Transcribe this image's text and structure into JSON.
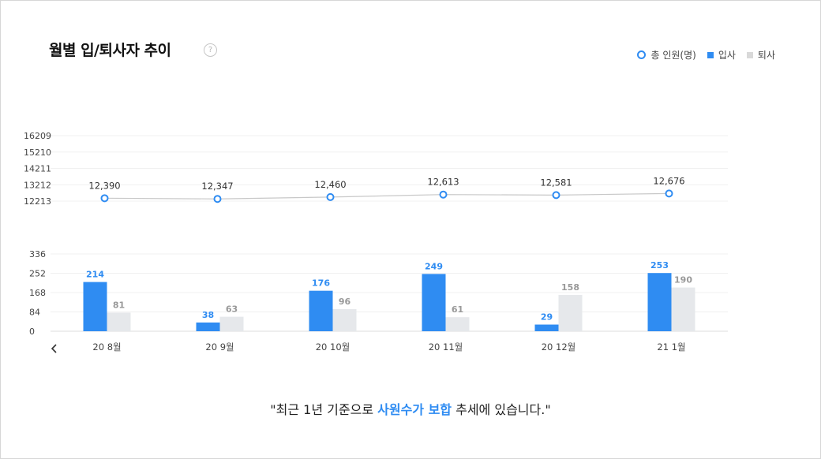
{
  "title": "월별 입/퇴사자 추이",
  "help_icon": "?",
  "legend": [
    {
      "label": "총 인원(명)",
      "marker": "circle",
      "color": "#2f8cf2"
    },
    {
      "label": "입사",
      "marker": "square",
      "color": "#2f8cf2"
    },
    {
      "label": "퇴사",
      "marker": "square",
      "color": "#d9d9d9"
    }
  ],
  "chart_data": [
    {
      "type": "line",
      "series": [
        {
          "name": "총 인원(명)",
          "values": [
            12390,
            12347,
            12460,
            12613,
            12581,
            12676
          ],
          "labels": [
            "12,390",
            "12,347",
            "12,460",
            "12,613",
            "12,581",
            "12,676"
          ]
        }
      ],
      "categories": [
        "20 8월",
        "20 9월",
        "20 10월",
        "20 11월",
        "20 12월",
        "21 1월"
      ],
      "yticks": [
        16209,
        15210,
        14211,
        13212,
        12213
      ],
      "ylim": [
        12213,
        16209
      ]
    },
    {
      "type": "bar",
      "categories": [
        "20 8월",
        "20 9월",
        "20 10월",
        "20 11월",
        "20 12월",
        "21 1월"
      ],
      "series": [
        {
          "name": "입사",
          "values": [
            214,
            38,
            176,
            249,
            29,
            253
          ]
        },
        {
          "name": "퇴사",
          "values": [
            81,
            63,
            96,
            61,
            158,
            190
          ]
        }
      ],
      "yticks": [
        336,
        252,
        168,
        84,
        0
      ],
      "ylim": [
        0,
        336
      ]
    }
  ],
  "colors": {
    "primary": "#2f8cf2",
    "bar_exit": "#e6e8eb",
    "bar_exit_label": "#999999",
    "line": "#c8c8c8",
    "grid": "#f0f0f0",
    "axis_text": "#444444"
  },
  "nav": {
    "prev_icon": "chevron-left-icon"
  },
  "summary": {
    "prefix": "\"최근 1년 기준으로 ",
    "highlight": "사원수가 보합",
    "suffix": " 추세에 있습니다.\""
  }
}
